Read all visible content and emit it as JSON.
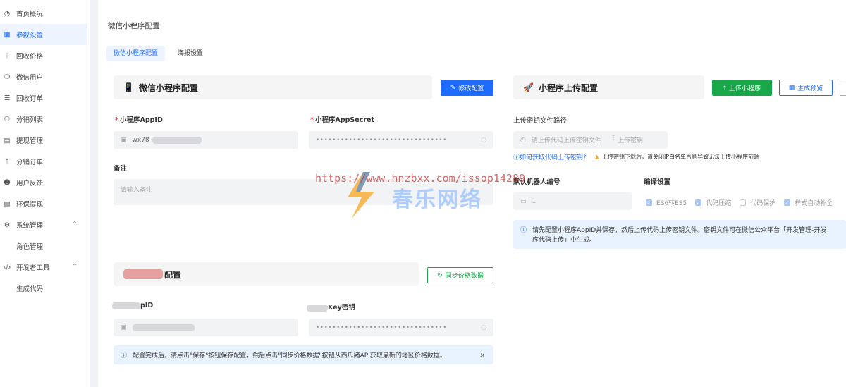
{
  "sidebar": {
    "items": [
      {
        "label": "首页概况",
        "icon": "dashboard-icon"
      },
      {
        "label": "参数设置",
        "icon": "grid-icon"
      },
      {
        "label": "回收价格",
        "icon": "branch-icon"
      },
      {
        "label": "微信用户",
        "icon": "wechat-icon"
      },
      {
        "label": "回收订单",
        "icon": "list-icon"
      },
      {
        "label": "分销列表",
        "icon": "user-icon"
      },
      {
        "label": "提现管理",
        "icon": "wallet-icon"
      },
      {
        "label": "分销订单",
        "icon": "branch-icon"
      },
      {
        "label": "用户反馈",
        "icon": "smile-icon"
      },
      {
        "label": "环保提现",
        "icon": "doc-icon"
      },
      {
        "label": "系统管理",
        "icon": "gear-icon"
      },
      {
        "label": "角色管理",
        "icon": ""
      },
      {
        "label": "开发者工具",
        "icon": "code-icon"
      },
      {
        "label": "生成代码",
        "icon": ""
      }
    ],
    "active_index": 1,
    "accent": "#1e6bff"
  },
  "page": {
    "title": "微信小程序配置",
    "tabs": [
      "微信小程序配置",
      "海报设置"
    ]
  },
  "wechat_config": {
    "heading": "微信小程序配置",
    "edit_button": "修改配置",
    "appid_label": "小程序AppID",
    "appid_value": "wx78",
    "secret_label": "小程序AppSecret",
    "secret_value": "••••••••••••••••••••••••••••••••",
    "remark_label": "备注",
    "remark_placeholder": "请输入备注"
  },
  "price_config": {
    "heading_suffix": "配置",
    "sync_button": "同步价格数据",
    "id_label_suffix": "pID",
    "key_label_suffix": "Key密钥",
    "key_value": "••••••••••••••••••••••••••••••••",
    "notice": "配置完成后，请点击\"保存\"按钮保存配置，然后点击\"同步价格数据\"按钮从西瓜猪API获取最新的地区价格数据。"
  },
  "upload_config": {
    "heading": "小程序上传配置",
    "upload_button": "上传小程序",
    "preview_button": "生成预览",
    "key_path_label": "上传密钥文件路径",
    "key_path_placeholder": "请上传代码上传密钥文件",
    "upload_key_button": "上传密钥",
    "how_to_link": "如何获取代码上传密钥?",
    "warning": "上传密钥下载后，请关闭IP白名单否则导致无法上传小程序前端",
    "robot_label": "默认机器人编号",
    "robot_value": "1",
    "compile_label": "编译设置",
    "compile_options": [
      {
        "label": "ES6转ES5",
        "checked": true
      },
      {
        "label": "代码压缩",
        "checked": true
      },
      {
        "label": "代码保护",
        "checked": false
      },
      {
        "label": "样式自动补全",
        "checked": true
      }
    ],
    "info_line1": "请先配置小程序AppID并保存，然后上传代码上传密钥文件。密钥文件可在微信公众平台「开发管理-开发",
    "info_line2": "序代码上传」中生成。"
  },
  "watermark": {
    "url": "https://www.hnzbxx.com/issop14289",
    "text": "春乐网络"
  }
}
